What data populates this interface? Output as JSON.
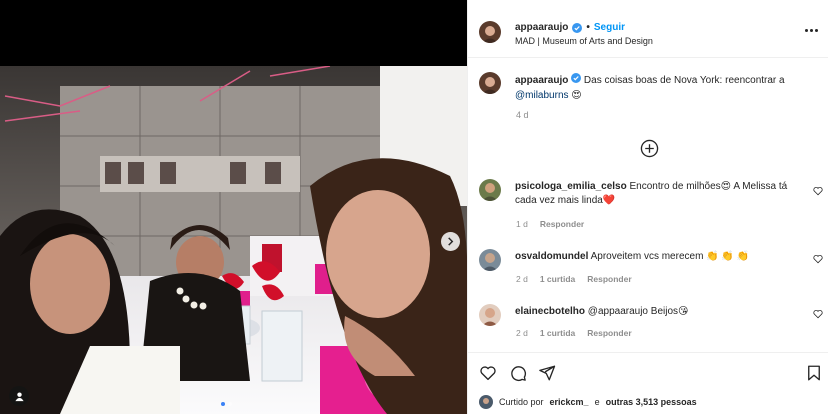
{
  "header": {
    "username": "appaaraujo",
    "separator": "•",
    "follow_label": "Seguir",
    "location": "MAD | Museum of Arts and Design"
  },
  "caption": {
    "username": "appaaraujo",
    "text": "Das coisas boas de Nova York: reencontrar a",
    "mention": "@milaburns",
    "emoji": "😍",
    "time": "4 d"
  },
  "comments": [
    {
      "username": "psicologa_emilia_celso",
      "text": "Encontro de milhões😍 A Melissa tá cada vez mais linda❤️",
      "time": "1 d",
      "likes": "",
      "reply_label": "Responder"
    },
    {
      "username": "osvaldomundel",
      "text": "Aproveitem vcs merecem 👏 👏 👏",
      "time": "2 d",
      "likes": "1 curtida",
      "reply_label": "Responder"
    },
    {
      "username": "elainecbotelho",
      "text": "@appaaraujo Beijos😘",
      "time": "2 d",
      "likes": "1 curtida",
      "reply_label": "Responder"
    }
  ],
  "likes_summary": {
    "prefix": "Curtido por",
    "user": "erickcm_",
    "middle": "e",
    "others": "outras 3,513 pessoas"
  },
  "icons": {
    "verified": "verified-badge-icon",
    "more": "more-options-icon",
    "load_more": "load-more-comments-icon",
    "like": "heart-icon",
    "comment": "comment-icon",
    "share": "share-icon",
    "save": "bookmark-icon",
    "next": "chevron-right-icon",
    "tag": "user-tag-icon"
  },
  "colors": {
    "accent": "#0095f6",
    "verified": "#3897f0",
    "text_secondary": "#8e8e8e",
    "mention": "#00376b"
  }
}
